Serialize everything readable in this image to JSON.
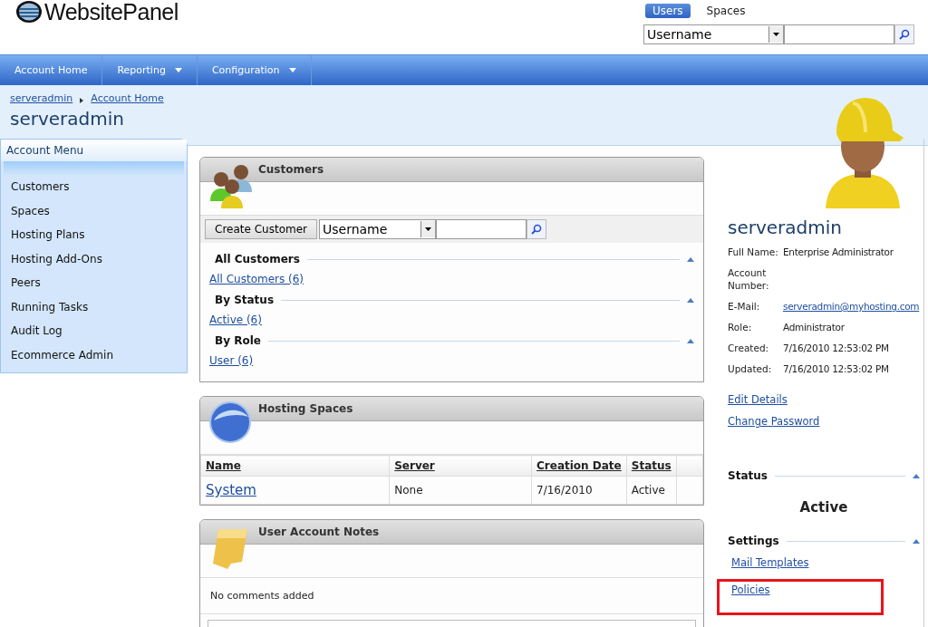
{
  "logo": {
    "text": "WebsitePanel"
  },
  "search_tabs": [
    {
      "label": "Users",
      "selected": true
    },
    {
      "label": "Spaces",
      "selected": false
    }
  ],
  "search": {
    "field": "Username"
  },
  "nav": [
    {
      "label": "Account Home",
      "dropdown": false
    },
    {
      "label": "Reporting",
      "dropdown": true
    },
    {
      "label": "Configuration",
      "dropdown": true
    }
  ],
  "breadcrumb": [
    "serveradmin",
    "Account Home"
  ],
  "page_title": "serveradmin",
  "account_menu": {
    "title": "Account Menu",
    "items": [
      "Customers",
      "Spaces",
      "Hosting Plans",
      "Hosting Add-Ons",
      "Peers",
      "Running Tasks",
      "Audit Log",
      "Ecommerce Admin"
    ]
  },
  "customers": {
    "title": "Customers",
    "create_button": "Create Customer",
    "search_field": "Username",
    "groups": [
      {
        "heading": "All Customers",
        "links": [
          "All Customers (6)"
        ]
      },
      {
        "heading": "By Status",
        "links": [
          "Active (6)"
        ]
      },
      {
        "heading": "By Role",
        "links": [
          "User (6)"
        ]
      }
    ]
  },
  "hosting_spaces": {
    "title": "Hosting Spaces",
    "columns": [
      "Name",
      "Server",
      "Creation Date",
      "Status"
    ],
    "rows": [
      [
        "System",
        "None",
        "7/16/2010",
        "Active"
      ]
    ]
  },
  "notes": {
    "title": "User Account Notes",
    "message": "No comments added"
  },
  "profile": {
    "name": "serveradmin",
    "fields": [
      {
        "label": "Full Name:",
        "value": "Enterprise Administrator",
        "kind": "text"
      },
      {
        "label": "Account Number:",
        "kind": "text"
      },
      {
        "label": "E-Mail:",
        "value": "serveradmin@myhosting.com",
        "kind": "link"
      },
      {
        "label": "Role:",
        "value": "Administrator",
        "kind": "text"
      },
      {
        "label": "Created:",
        "value": "7/16/2010 12:53:02 PM",
        "kind": "text"
      },
      {
        "label": "Updated:",
        "value": "7/16/2010 12:53:02 PM",
        "kind": "text"
      }
    ],
    "links": [
      "Edit Details",
      "Change Password"
    ]
  },
  "status": {
    "heading": "Status",
    "value": "Active"
  },
  "settings": {
    "heading": "Settings",
    "links": [
      {
        "label": "Mail Templates",
        "highlighted": false
      },
      {
        "label": "Policies",
        "highlighted": true
      }
    ]
  }
}
